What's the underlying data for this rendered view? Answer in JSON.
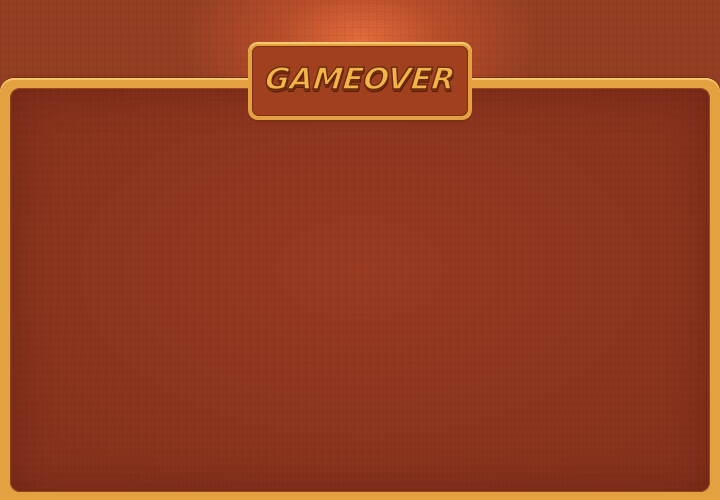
{
  "screen": {
    "title": "GAMEOVER"
  },
  "colors": {
    "background": "#8f3a20",
    "frame_gold": "#e4a13f",
    "panel_fill": "#9b3b22",
    "title_text": "#f2b447"
  }
}
